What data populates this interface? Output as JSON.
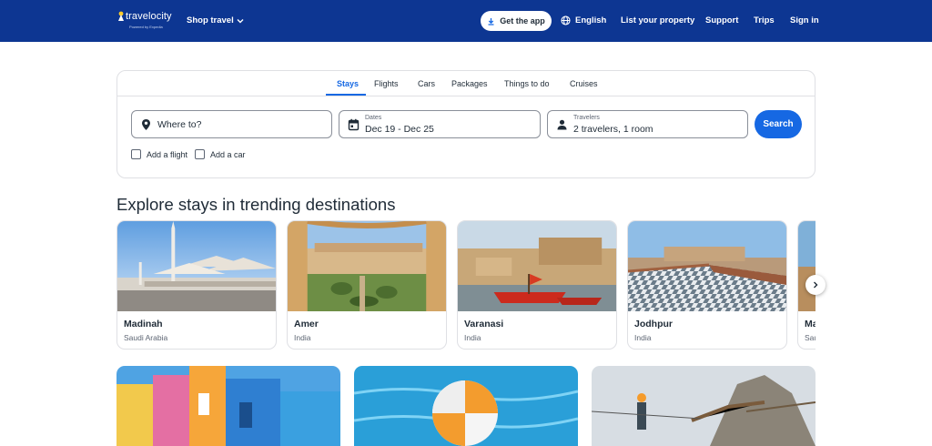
{
  "header": {
    "logo_text": "travelocity",
    "logo_tagline": "Powered by Expedia",
    "shop_travel": "Shop travel",
    "get_app": "Get the app",
    "language": "English",
    "list_property": "List your property",
    "support": "Support",
    "trips": "Trips",
    "sign_in": "Sign in"
  },
  "search": {
    "tabs": [
      "Stays",
      "Flights",
      "Cars",
      "Packages",
      "Things to do",
      "Cruises"
    ],
    "active_tab": "Stays",
    "where_placeholder": "Where to?",
    "dates_label": "Dates",
    "dates_value": "Dec 19 - Dec 25",
    "travelers_label": "Travelers",
    "travelers_value": "2 travelers, 1 room",
    "search_button": "Search",
    "add_flight": "Add a flight",
    "add_car": "Add a car"
  },
  "trending": {
    "title": "Explore stays in trending destinations",
    "destinations": [
      {
        "name": "Madinah",
        "country": "Saudi Arabia"
      },
      {
        "name": "Amer",
        "country": "India"
      },
      {
        "name": "Varanasi",
        "country": "India"
      },
      {
        "name": "Jodhpur",
        "country": "India"
      },
      {
        "name": "Ma",
        "country": "Sau"
      }
    ]
  },
  "colors": {
    "header_bg": "#0d3692",
    "accent": "#1668e3",
    "text": "#1f2b37"
  },
  "icons": [
    "download-icon",
    "globe-icon",
    "chevron-down-icon",
    "map-pin-icon",
    "calendar-icon",
    "person-icon",
    "chevron-right-icon"
  ]
}
